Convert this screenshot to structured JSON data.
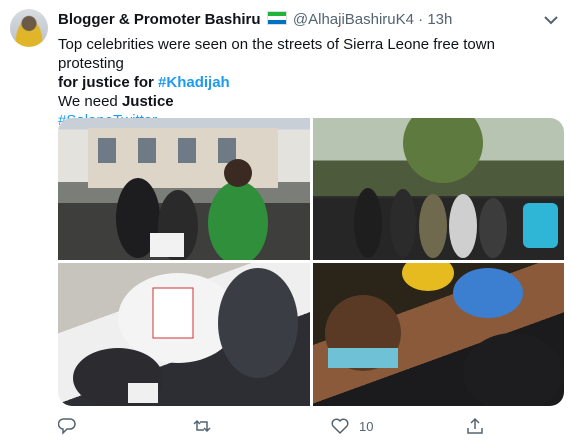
{
  "tweet": {
    "author_name": "Blogger & Promoter Bashiru",
    "handle": "@AlhajiBashiruK4",
    "separator": "·",
    "time": "13h",
    "text_line1": "Top celebrities were seen on the streets of Sierra Leone free town protesting ",
    "text_bold1": "for justice for ",
    "hashtag1": "#Khadijah",
    "text_line3_plain": "We need ",
    "text_line3_bold": "Justice",
    "hashtag2": "#SaloneTwitter"
  },
  "flag_colors": [
    "#1eb53a",
    "#ffffff",
    "#0072c6"
  ],
  "actions": {
    "reply_icon": "reply-icon",
    "retweet_icon": "retweet-icon",
    "like_icon": "heart-icon",
    "like_count": "10",
    "share_icon": "share-icon"
  },
  "colors": {
    "link": "#1d9bf0",
    "muted": "#536471"
  }
}
